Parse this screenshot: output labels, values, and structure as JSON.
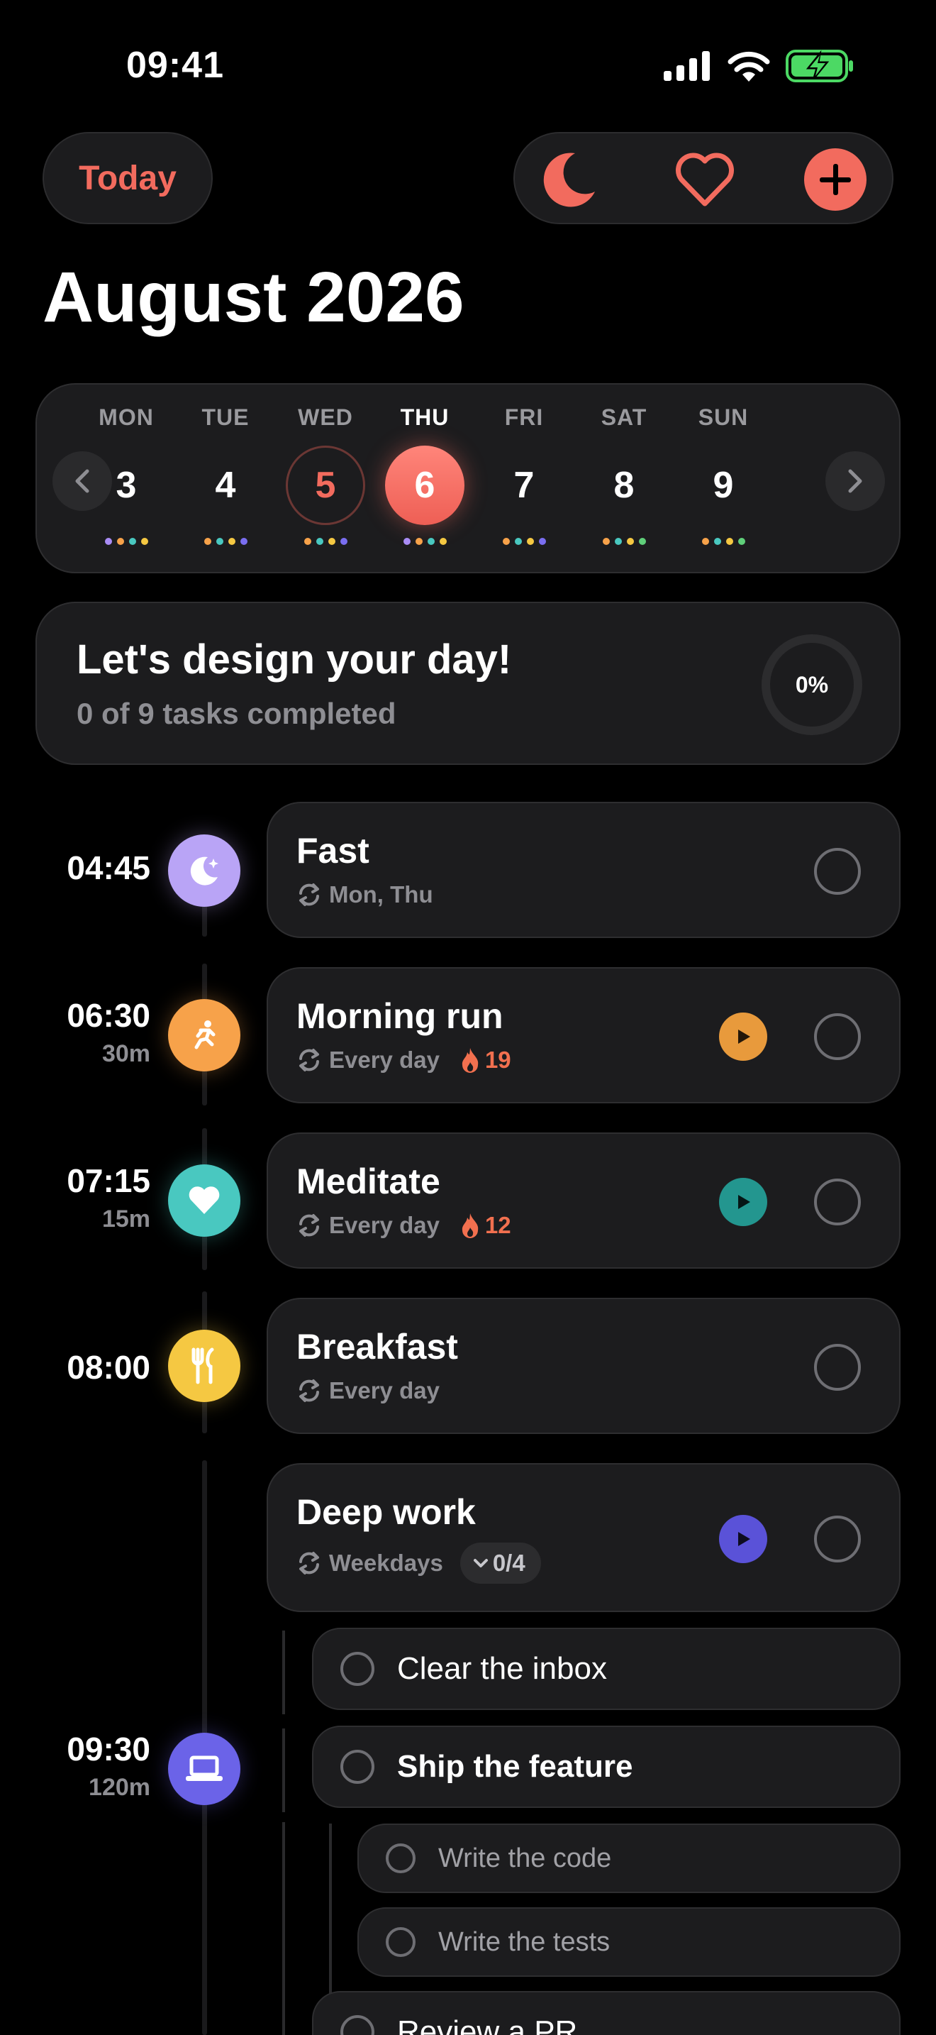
{
  "status": {
    "time": "09:41"
  },
  "header": {
    "today_label": "Today",
    "month_title": "August 2026"
  },
  "week": [
    {
      "name": "MON",
      "num": "3",
      "dots": [
        "#a98cf5",
        "#f7a24a",
        "#49c8c0",
        "#f5c842"
      ]
    },
    {
      "name": "TUE",
      "num": "4",
      "dots": [
        "#f7a24a",
        "#49c8c0",
        "#f5c842",
        "#7a6ef0"
      ]
    },
    {
      "name": "WED",
      "num": "5",
      "dots": [
        "#f7a24a",
        "#49c8c0",
        "#f5c842",
        "#7a6ef0"
      ]
    },
    {
      "name": "THU",
      "num": "6",
      "dots": [
        "#a98cf5",
        "#f7a24a",
        "#49c8c0",
        "#f5c842"
      ]
    },
    {
      "name": "FRI",
      "num": "7",
      "dots": [
        "#f7a24a",
        "#49c8c0",
        "#f5c842",
        "#7a6ef0"
      ]
    },
    {
      "name": "SAT",
      "num": "8",
      "dots": [
        "#f7a24a",
        "#49c8c0",
        "#f5c842",
        "#5fcf7a"
      ]
    },
    {
      "name": "SUN",
      "num": "9",
      "dots": [
        "#f7a24a",
        "#49c8c0",
        "#f5c842",
        "#5fcf7a"
      ]
    }
  ],
  "progress": {
    "title": "Let's design your day!",
    "subtitle": "0 of 9 tasks completed",
    "percent": "0%"
  },
  "tasks": [
    {
      "time": "04:45",
      "duration": "",
      "title": "Fast",
      "repeat": "Mon, Thu",
      "streak": "",
      "badge_color": "#b9a4f6",
      "play_color": ""
    },
    {
      "time": "06:30",
      "duration": "30m",
      "title": "Morning run",
      "repeat": "Every day",
      "streak": "19",
      "badge_color": "#f7a24a",
      "play_color": "#e89a3c"
    },
    {
      "time": "07:15",
      "duration": "15m",
      "title": "Meditate",
      "repeat": "Every day",
      "streak": "12",
      "badge_color": "#49c8c0",
      "play_color": "#23968f"
    },
    {
      "time": "08:00",
      "duration": "",
      "title": "Breakfast",
      "repeat": "Every day",
      "streak": "",
      "badge_color": "#f5c842",
      "play_color": ""
    },
    {
      "time": "09:30",
      "duration": "120m",
      "title": "Deep work",
      "repeat": "Weekdays",
      "subtask_count": "0/4",
      "badge_color": "#6b63e8",
      "play_color": "#5a52d8"
    }
  ],
  "subtasks": [
    {
      "label": "Clear the inbox"
    },
    {
      "label": "Ship the feature"
    },
    {
      "label": "Write the code"
    },
    {
      "label": "Write the tests"
    },
    {
      "label": "Review a PR"
    }
  ]
}
